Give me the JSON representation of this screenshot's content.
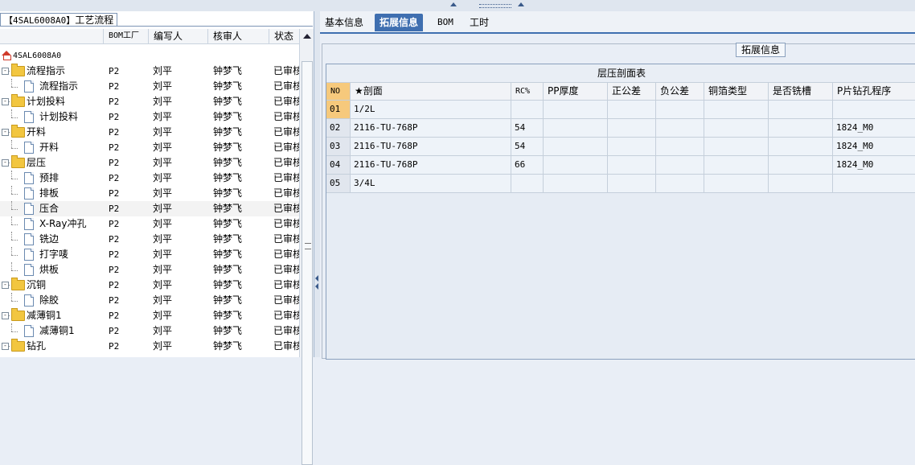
{
  "left_panel": {
    "title_code": "【4SAL6008A0】",
    "title_text": "工艺流程",
    "columns": [
      "BOM工厂",
      "编写人",
      "核审人",
      "状态"
    ],
    "root": "4SAL6008A0",
    "rows": [
      {
        "name": "流程指示",
        "level": 1,
        "type": "folder",
        "factory": "P2",
        "writer": "刘平",
        "reviewer": "钟梦飞",
        "status": "已审核"
      },
      {
        "name": "流程指示",
        "level": 2,
        "type": "doc",
        "factory": "P2",
        "writer": "刘平",
        "reviewer": "钟梦飞",
        "status": "已审核"
      },
      {
        "name": "计划投料",
        "level": 1,
        "type": "folder",
        "factory": "P2",
        "writer": "刘平",
        "reviewer": "钟梦飞",
        "status": "已审核"
      },
      {
        "name": "计划投料",
        "level": 2,
        "type": "doc",
        "factory": "P2",
        "writer": "刘平",
        "reviewer": "钟梦飞",
        "status": "已审核"
      },
      {
        "name": "开料",
        "level": 1,
        "type": "folder",
        "factory": "P2",
        "writer": "刘平",
        "reviewer": "钟梦飞",
        "status": "已审核"
      },
      {
        "name": "开料",
        "level": 2,
        "type": "doc",
        "factory": "P2",
        "writer": "刘平",
        "reviewer": "钟梦飞",
        "status": "已审核"
      },
      {
        "name": "层压",
        "level": 1,
        "type": "folder",
        "factory": "P2",
        "writer": "刘平",
        "reviewer": "钟梦飞",
        "status": "已审核"
      },
      {
        "name": "预排",
        "level": 2,
        "type": "doc",
        "factory": "P2",
        "writer": "刘平",
        "reviewer": "钟梦飞",
        "status": "已审核"
      },
      {
        "name": "排板",
        "level": 2,
        "type": "doc",
        "factory": "P2",
        "writer": "刘平",
        "reviewer": "钟梦飞",
        "status": "已审核"
      },
      {
        "name": "压合",
        "level": 2,
        "type": "doc",
        "factory": "P2",
        "writer": "刘平",
        "reviewer": "钟梦飞",
        "status": "已审核",
        "selected": true
      },
      {
        "name": "X-Ray冲孔",
        "level": 2,
        "type": "doc",
        "factory": "P2",
        "writer": "刘平",
        "reviewer": "钟梦飞",
        "status": "已审核"
      },
      {
        "name": "铣边",
        "level": 2,
        "type": "doc",
        "factory": "P2",
        "writer": "刘平",
        "reviewer": "钟梦飞",
        "status": "已审核"
      },
      {
        "name": "打字唛",
        "level": 2,
        "type": "doc",
        "factory": "P2",
        "writer": "刘平",
        "reviewer": "钟梦飞",
        "status": "已审核"
      },
      {
        "name": "烘板",
        "level": 2,
        "type": "doc",
        "factory": "P2",
        "writer": "刘平",
        "reviewer": "钟梦飞",
        "status": "已审核"
      },
      {
        "name": "沉铜",
        "level": 1,
        "type": "folder",
        "factory": "P2",
        "writer": "刘平",
        "reviewer": "钟梦飞",
        "status": "已审核"
      },
      {
        "name": "除胶",
        "level": 2,
        "type": "doc",
        "factory": "P2",
        "writer": "刘平",
        "reviewer": "钟梦飞",
        "status": "已审核"
      },
      {
        "name": "减薄铜1",
        "level": 1,
        "type": "folder",
        "factory": "P2",
        "writer": "刘平",
        "reviewer": "钟梦飞",
        "status": "已审核"
      },
      {
        "name": "减薄铜1",
        "level": 2,
        "type": "doc",
        "factory": "P2",
        "writer": "刘平",
        "reviewer": "钟梦飞",
        "status": "已审核"
      },
      {
        "name": "钻孔",
        "level": 1,
        "type": "folder",
        "factory": "P2",
        "writer": "刘平",
        "reviewer": "钟梦飞",
        "status": "已审核"
      }
    ]
  },
  "tabs": [
    {
      "label": "基本信息",
      "active": false
    },
    {
      "label": "拓展信息",
      "active": true
    },
    {
      "label": "BOM",
      "active": false
    },
    {
      "label": "工时",
      "active": false
    }
  ],
  "section_label": "拓展信息",
  "grid": {
    "title": "层压剖面表",
    "columns": [
      "NO",
      "★剖面",
      "RC%",
      "PP厚度",
      "正公差",
      "负公差",
      "铜箔类型",
      "是否铣槽",
      "P片钻孔程序"
    ],
    "rows": [
      [
        "01",
        "1/2L",
        "",
        "",
        "",
        "",
        "",
        "",
        ""
      ],
      [
        "02",
        "2116-TU-768P",
        "54",
        "",
        "",
        "",
        "",
        "",
        "1824_M0"
      ],
      [
        "03",
        "2116-TU-768P",
        "54",
        "",
        "",
        "",
        "",
        "",
        "1824_M0"
      ],
      [
        "04",
        "2116-TU-768P",
        "66",
        "",
        "",
        "",
        "",
        "",
        "1824_M0"
      ],
      [
        "05",
        "3/4L",
        "",
        "",
        "",
        "",
        "",
        "",
        ""
      ]
    ]
  }
}
